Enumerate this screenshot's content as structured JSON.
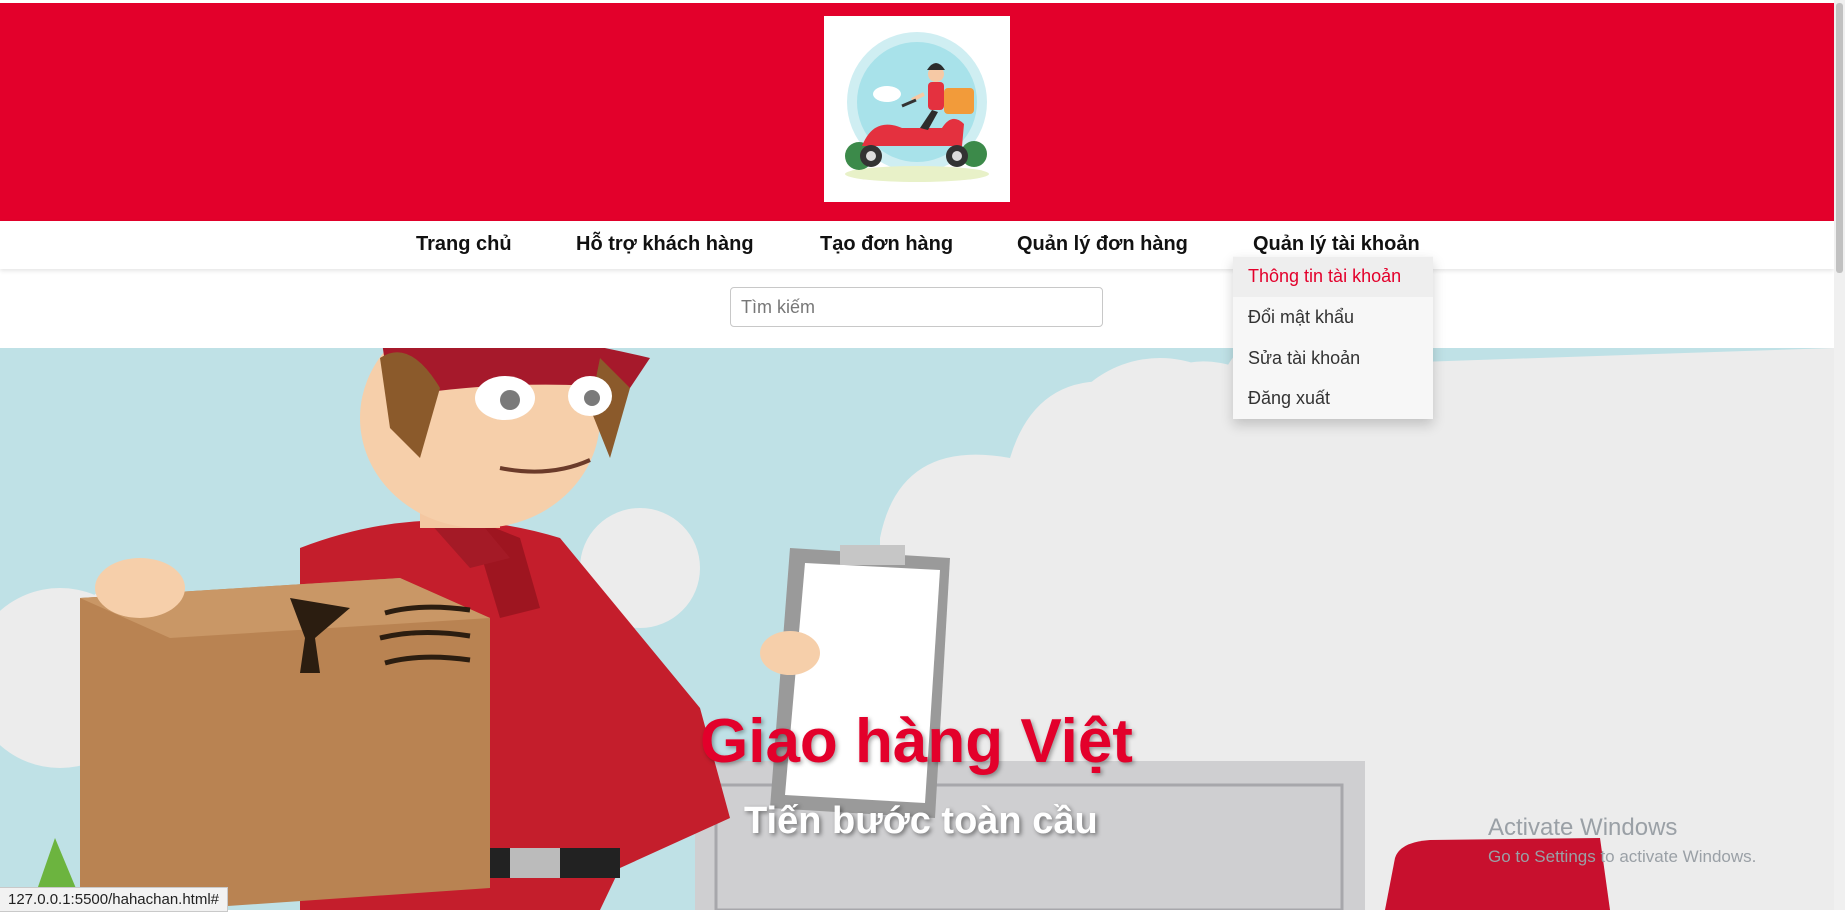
{
  "header": {
    "logo": "delivery-scooter-logo",
    "brand_color": "#e3002b"
  },
  "nav": {
    "items": [
      {
        "label": "Trang chủ"
      },
      {
        "label": "Hỗ trợ khách hàng"
      },
      {
        "label": "Tạo đơn hàng"
      },
      {
        "label": "Quản lý đơn hàng"
      },
      {
        "label": "Quản lý tài khoản"
      }
    ]
  },
  "account_menu": {
    "items": [
      {
        "label": "Thông tin tài khoản",
        "active": true
      },
      {
        "label": "Đổi mật khẩu"
      },
      {
        "label": "Sửa tài khoản"
      },
      {
        "label": "Đăng xuất"
      }
    ]
  },
  "search": {
    "placeholder": "Tìm kiếm",
    "value": ""
  },
  "hero": {
    "title": "Giao hàng Việt",
    "subtitle": "Tiến bước toàn cầu"
  },
  "watermark": {
    "title": "Activate Windows",
    "subtitle": "Go to Settings to activate Windows."
  },
  "status_bar": {
    "url": "127.0.0.1:5500/hahachan.html#"
  }
}
